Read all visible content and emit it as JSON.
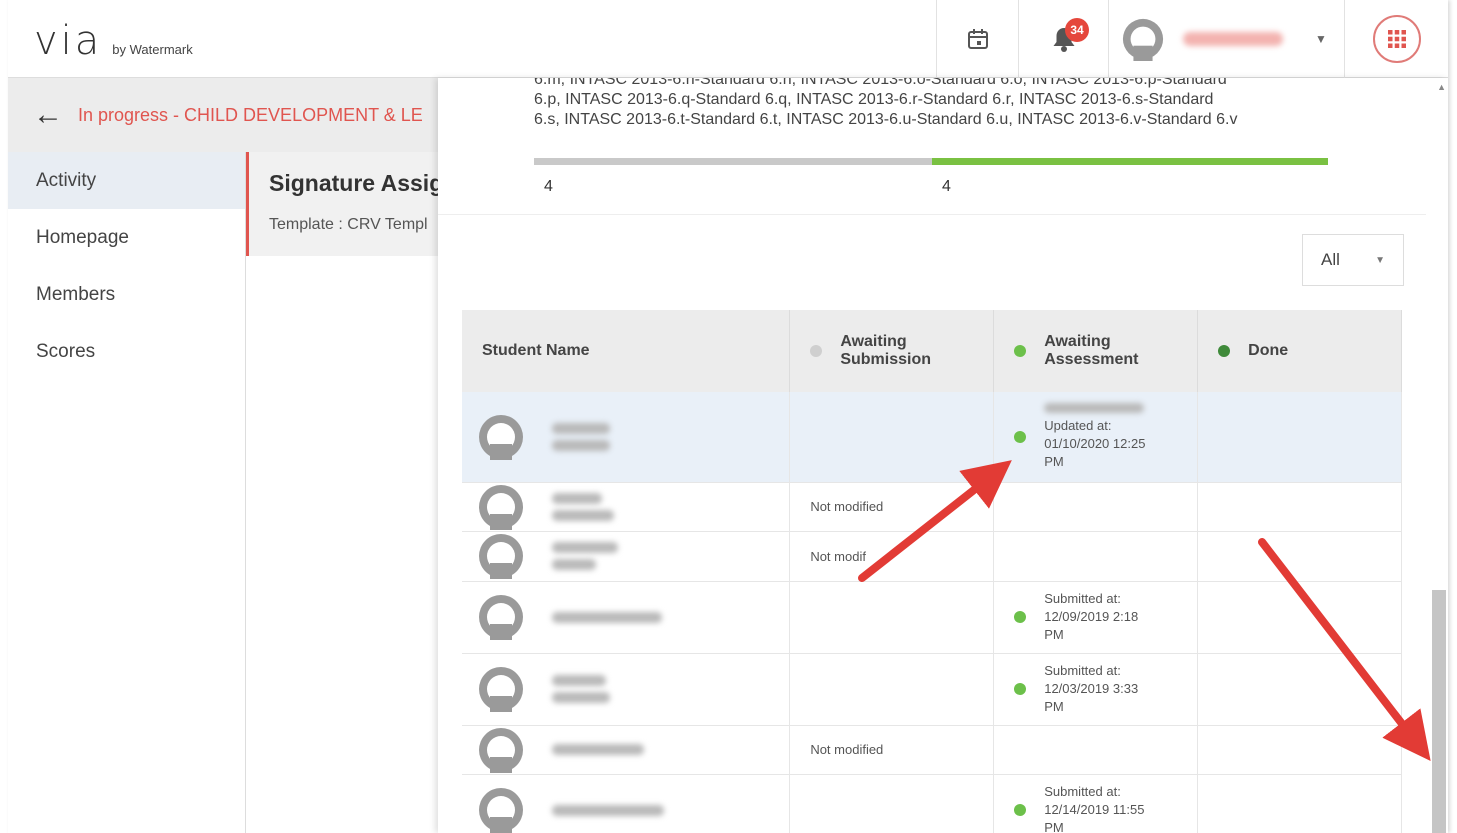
{
  "header": {
    "logo_main": "via",
    "logo_sub": "by Watermark",
    "notification_count": "34",
    "apps_icon": "grid-icon",
    "calendar_icon": "calendar-icon",
    "bell_icon": "bell-icon"
  },
  "breadcrumb": {
    "text": "In progress - CHILD DEVELOPMENT & LE"
  },
  "sidebar": {
    "items": [
      {
        "label": "Activity"
      },
      {
        "label": "Homepage"
      },
      {
        "label": "Members"
      },
      {
        "label": "Scores"
      }
    ]
  },
  "assignment": {
    "title": "Signature Assign",
    "template_label": "Template :",
    "template_value": "CRV Templ"
  },
  "standards": {
    "lines": [
      "6.m,   INTASC 2013-6.n-Standard 6.n,   INTASC 2013-6.o-Standard 6.o,   INTASC 2013-6.p-Standard",
      "6.p,   INTASC 2013-6.q-Standard 6.q,   INTASC 2013-6.r-Standard 6.r,   INTASC 2013-6.s-Standard",
      "6.s,   INTASC 2013-6.t-Standard 6.t,   INTASC 2013-6.u-Standard 6.u,   INTASC 2013-6.v-Standard 6.v"
    ]
  },
  "progress": {
    "left_count": "4",
    "right_count": "4",
    "gray_fraction": 0.5,
    "green_fraction": 0.5
  },
  "filter": {
    "value": "All"
  },
  "table": {
    "headers": {
      "student": "Student Name",
      "awaiting_submission": "Awaiting Submission",
      "awaiting_assessment": "Awaiting Assessment",
      "done": "Done"
    },
    "rows": [
      {
        "submission": "",
        "assessment_label": "Updated at:",
        "assessment_date": "01/10/2020 12:25",
        "assessment_time": "PM"
      },
      {
        "submission": "Not modified",
        "assessment_label": "",
        "assessment_date": "",
        "assessment_time": ""
      },
      {
        "submission": "Not modif",
        "assessment_label": "",
        "assessment_date": "",
        "assessment_time": ""
      },
      {
        "submission": "",
        "assessment_label": "Submitted at:",
        "assessment_date": "12/09/2019 2:18",
        "assessment_time": "PM"
      },
      {
        "submission": "",
        "assessment_label": "Submitted at:",
        "assessment_date": "12/03/2019 3:33",
        "assessment_time": "PM"
      },
      {
        "submission": "Not modified",
        "assessment_label": "",
        "assessment_date": "",
        "assessment_time": ""
      },
      {
        "submission": "",
        "assessment_label": "Submitted at:",
        "assessment_date": "12/14/2019 11:55",
        "assessment_time": "PM"
      }
    ]
  },
  "colors": {
    "accent": "#e0554f",
    "progress_green": "#7ac142",
    "dot_light_green": "#6cc04a",
    "dot_dark_green": "#3f8a3a",
    "arrow_red": "#e23b35"
  }
}
